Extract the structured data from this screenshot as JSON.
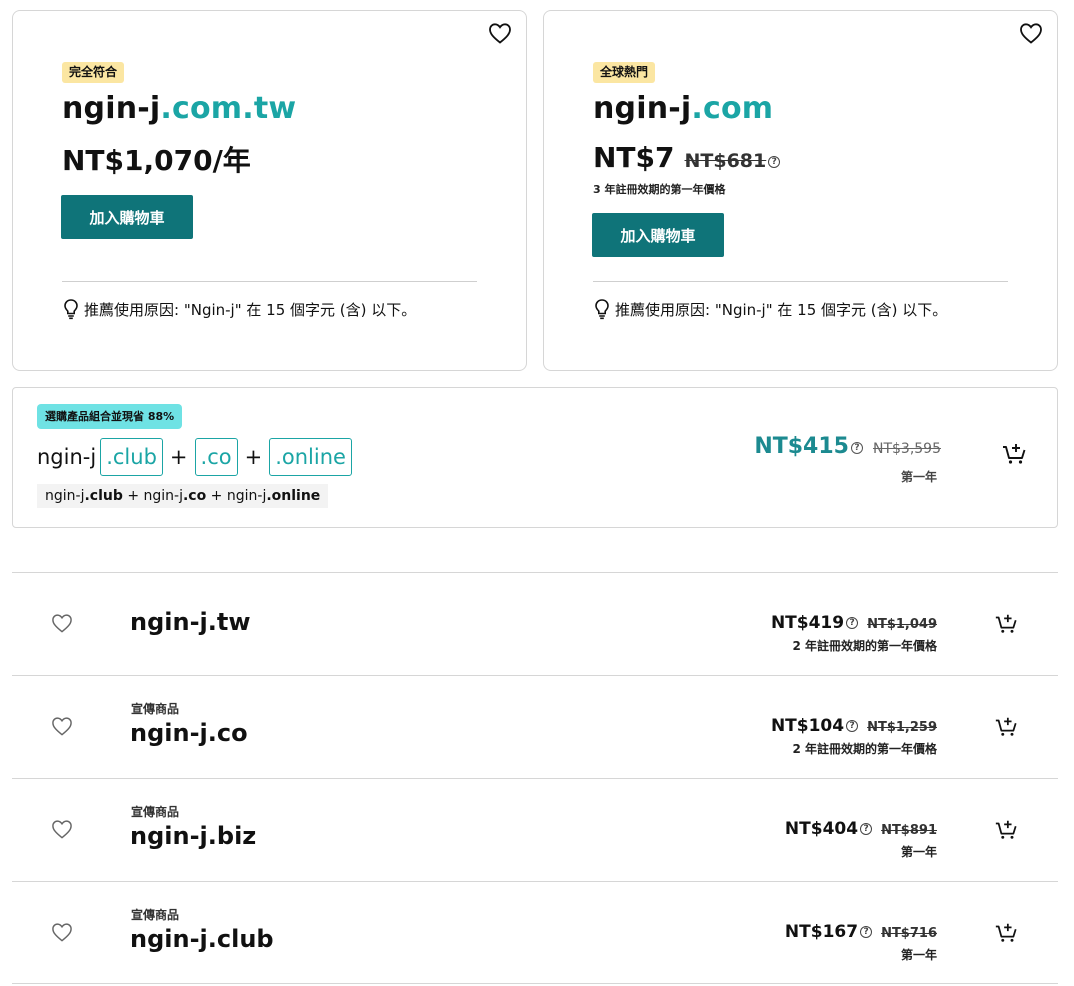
{
  "featured": [
    {
      "badge": "完全符合",
      "domain_base": "ngin-j",
      "domain_tld": ".com.tw",
      "price": "NT$1,070/年",
      "cart_label": "加入購物車",
      "reason": "推薦使用原因: \"Ngin-j\" 在 15 個字元 (含) 以下。"
    },
    {
      "badge": "全球熱門",
      "domain_base": "ngin-j",
      "domain_tld": ".com",
      "price_now": "NT$7",
      "price_old": "NT$681",
      "term": "3 年註冊效期的第一年價格",
      "cart_label": "加入購物車",
      "reason": "推薦使用原因: \"Ngin-j\" 在 15 個字元 (含) 以下。"
    }
  ],
  "bundle": {
    "badge": "選購產品組合並現省 88%",
    "base": "ngin-j",
    "tlds": [
      ".club",
      ".co",
      ".online"
    ],
    "plus": "+",
    "sub_parts": [
      "ngin-j",
      ".club",
      " + ngin-j",
      ".co",
      " + ngin-j",
      ".online"
    ],
    "price_now": "NT$415",
    "price_old": "NT$3,595",
    "term": "第一年"
  },
  "results": [
    {
      "promo": "",
      "domain": "ngin-j.tw",
      "price_now": "NT$419",
      "price_old": "NT$1,049",
      "term": "2 年註冊效期的第一年價格"
    },
    {
      "promo": "宣傳商品",
      "domain": "ngin-j.co",
      "price_now": "NT$104",
      "price_old": "NT$1,259",
      "term": "2 年註冊效期的第一年價格"
    },
    {
      "promo": "宣傳商品",
      "domain": "ngin-j.biz",
      "price_now": "NT$404",
      "price_old": "NT$891",
      "term": "第一年"
    },
    {
      "promo": "宣傳商品",
      "domain": "ngin-j.club",
      "price_now": "NT$167",
      "price_old": "NT$716",
      "term": "第一年"
    }
  ],
  "info_icon": "?",
  "colors": {
    "teal_tld": "#1ba5a5",
    "button": "#0f7479",
    "badge_yellow": "#fbe6a2",
    "bundle_badge": "#6fe2e4",
    "bundle_price": "#1c8a90"
  }
}
